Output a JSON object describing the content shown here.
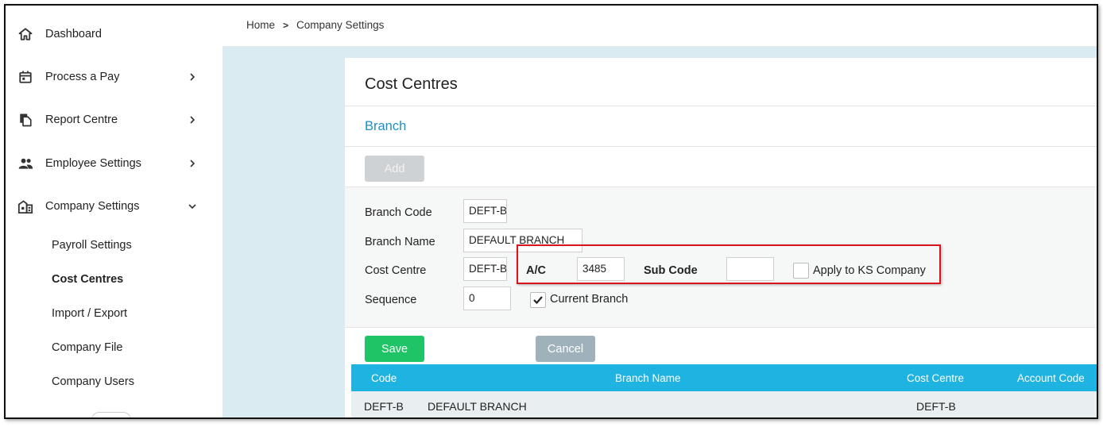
{
  "sidebar": {
    "items": [
      {
        "label": "Dashboard",
        "icon": "home-icon"
      },
      {
        "label": "Process a Pay",
        "icon": "calendar-icon"
      },
      {
        "label": "Report Centre",
        "icon": "documents-icon"
      },
      {
        "label": "Employee Settings",
        "icon": "people-icon"
      },
      {
        "label": "Company Settings",
        "icon": "building-icon"
      }
    ],
    "sub_items": [
      "Payroll Settings",
      "Cost Centres",
      "Import / Export",
      "Company File",
      "Company Users"
    ]
  },
  "breadcrumb": {
    "home": "Home",
    "current": "Company Settings"
  },
  "card": {
    "title": "Cost Centres",
    "section": "Branch",
    "add_label": "Add"
  },
  "form": {
    "branch_code_label": "Branch Code",
    "branch_code_value": "DEFT-B",
    "branch_name_label": "Branch Name",
    "branch_name_value": "DEFAULT BRANCH",
    "cost_centre_label": "Cost Centre",
    "cost_centre_value": "DEFT-B",
    "ac_label": "A/C",
    "ac_value": "3485",
    "sub_code_label": "Sub Code",
    "sub_code_value": "",
    "apply_ks_label": "Apply to KS Company",
    "apply_ks_checked": false,
    "sequence_label": "Sequence",
    "sequence_value": "0",
    "current_branch_label": "Current Branch",
    "current_branch_checked": true
  },
  "buttons": {
    "save": "Save",
    "cancel": "Cancel"
  },
  "table": {
    "headers": [
      "Code",
      "Branch Name",
      "Cost Centre",
      "Account Code"
    ],
    "rows": [
      [
        "DEFT-B",
        "DEFAULT BRANCH",
        "DEFT-B",
        ""
      ]
    ]
  },
  "colors": {
    "accent": "#1fb3e2",
    "save": "#1fc466",
    "link": "#1b8fc6",
    "highlight": "#d9141c"
  }
}
